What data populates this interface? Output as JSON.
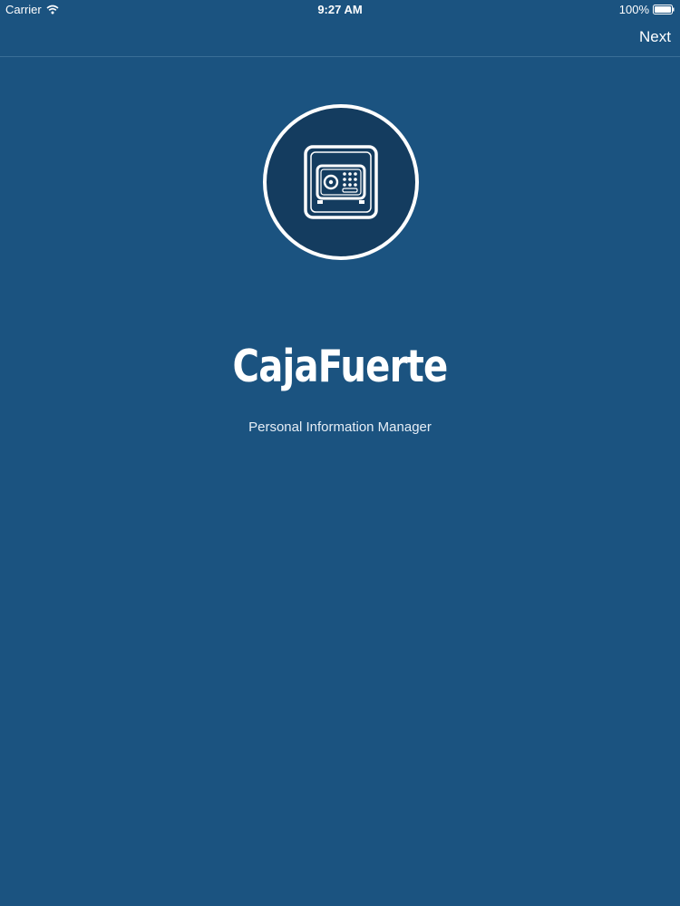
{
  "status_bar": {
    "carrier": "Carrier",
    "time": "9:27 AM",
    "battery": "100%",
    "wifi_icon": "wifi-icon",
    "battery_icon": "battery-icon"
  },
  "nav": {
    "next_label": "Next"
  },
  "logo": {
    "icon": "safe-icon"
  },
  "app": {
    "title": "CajaFuerte",
    "subtitle": "Personal Information Manager"
  },
  "colors": {
    "background": "#1b5380",
    "logo_fill": "#143c5f",
    "foreground": "#ffffff"
  }
}
